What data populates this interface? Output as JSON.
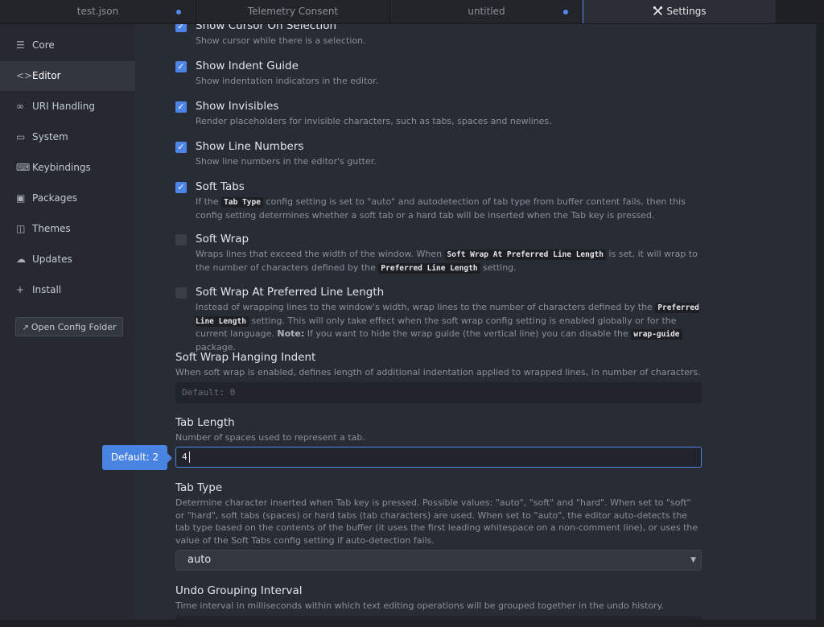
{
  "tabs": [
    {
      "label": "test.json",
      "modified": true
    },
    {
      "label": "Telemetry Consent",
      "modified": false
    },
    {
      "label": "untitled",
      "modified": true
    },
    {
      "label": "Settings",
      "icon": "tools-icon",
      "active": true
    }
  ],
  "sidebar": {
    "items": [
      {
        "label": "Core",
        "icon": "sliders-icon"
      },
      {
        "label": "Editor",
        "icon": "code-icon",
        "active": true
      },
      {
        "label": "URI Handling",
        "icon": "link-icon"
      },
      {
        "label": "System",
        "icon": "monitor-icon"
      },
      {
        "label": "Keybindings",
        "icon": "keyboard-icon"
      },
      {
        "label": "Packages",
        "icon": "package-icon"
      },
      {
        "label": "Themes",
        "icon": "paintcan-icon"
      },
      {
        "label": "Updates",
        "icon": "cloud-download-icon"
      },
      {
        "label": "Install",
        "icon": "plus-icon"
      }
    ],
    "open_config_label": "Open Config Folder"
  },
  "settings": {
    "show_cursor_on_selection": {
      "title": "Show Cursor On Selection",
      "desc": "Show cursor while there is a selection.",
      "checked": true
    },
    "show_indent_guide": {
      "title": "Show Indent Guide",
      "desc": "Show indentation indicators in the editor.",
      "checked": true
    },
    "show_invisibles": {
      "title": "Show Invisibles",
      "desc": "Render placeholders for invisible characters, such as tabs, spaces and newlines.",
      "checked": true
    },
    "show_line_numbers": {
      "title": "Show Line Numbers",
      "desc": "Show line numbers in the editor's gutter.",
      "checked": true
    },
    "soft_tabs": {
      "title": "Soft Tabs",
      "checked": true,
      "desc_1": "If the",
      "code_1": "Tab Type",
      "desc_2": "config setting is set to \"auto\" and autodetection of tab type from buffer content fails, then this config setting determines whether a soft tab or a hard tab will be inserted when the Tab key is pressed."
    },
    "soft_wrap": {
      "title": "Soft Wrap",
      "checked": false,
      "desc_1": "Wraps lines that exceed the width of the window. When",
      "code_1": "Soft Wrap At Preferred Line Length",
      "desc_2": "is set, it will wrap to the number of characters defined by the",
      "code_2": "Preferred Line Length",
      "desc_3": "setting."
    },
    "soft_wrap_preferred": {
      "title": "Soft Wrap At Preferred Line Length",
      "checked": false,
      "desc_1": "Instead of wrapping lines to the window's width, wrap lines to the number of characters defined by the",
      "code_1": "Preferred Line Length",
      "desc_2": "setting. This will only take effect when the soft wrap config setting is enabled globally or for the current language.",
      "note_label": "Note:",
      "desc_3": "If you want to hide the wrap guide (the vertical line) you can disable the",
      "code_2": "wrap-guide",
      "desc_4": "package."
    },
    "soft_wrap_hanging_indent": {
      "title": "Soft Wrap Hanging Indent",
      "desc": "When soft wrap is enabled, defines length of additional indentation applied to wrapped lines, in number of characters.",
      "placeholder": "Default: 0"
    },
    "tab_length": {
      "title": "Tab Length",
      "desc": "Number of spaces used to represent a tab.",
      "value": "4",
      "tooltip": "Default: 2"
    },
    "tab_type": {
      "title": "Tab Type",
      "desc": "Determine character inserted when Tab key is pressed. Possible values: \"auto\", \"soft\" and \"hard\". When set to \"soft\" or \"hard\", soft tabs (spaces) or hard tabs (tab characters) are used. When set to \"auto\", the editor auto-detects the tab type based on the contents of the buffer (it uses the first leading whitespace on a non-comment line), or uses the value of the Soft Tabs config setting if auto-detection fails.",
      "selected": "auto"
    },
    "undo_grouping_interval": {
      "title": "Undo Grouping Interval",
      "desc": "Time interval in milliseconds within which text editing operations will be grouped together in the undo history."
    }
  },
  "colors": {
    "accent": "#4d84e8",
    "background": "#282c34",
    "sidebar": "#262930"
  }
}
